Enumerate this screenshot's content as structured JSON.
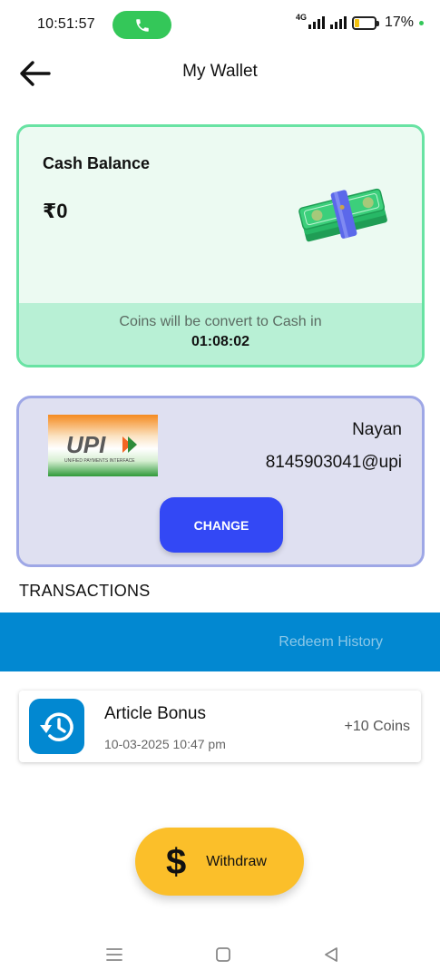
{
  "status_bar": {
    "time": "10:51:57",
    "network": "4G",
    "battery_percent": "17%",
    "battery_level": 0.17,
    "colors": {
      "call_pill": "#34c759",
      "battery_fill": "#f4c20d"
    }
  },
  "header": {
    "title": "My Wallet",
    "back_icon": "arrow-left-icon"
  },
  "cash_card": {
    "title": "Cash Balance",
    "amount": "₹0",
    "convert_text": "Coins will be convert to Cash in",
    "timer": "01:08:02",
    "illustration": "money-stack-icon",
    "colors": {
      "border": "#68e3a3",
      "background": "#ecfaf2",
      "band": "#b8f0d5"
    }
  },
  "upi_card": {
    "logo_text": "UPI",
    "logo_subtext": "UNIFIED PAYMENTS INTERFACE",
    "name": "Nayan",
    "upi_id": "8145903041@upi",
    "change_label": "CHANGE",
    "colors": {
      "border": "#9ea7e6",
      "background": "#dfe0f1",
      "button": "#3348f5"
    }
  },
  "transactions": {
    "heading": "TRANSACTIONS",
    "tabs": [
      {
        "label": "Redeem History",
        "active": false
      }
    ],
    "items": [
      {
        "title": "Article Bonus",
        "date": "10-03-2025 10:47 pm",
        "amount": "+10 Coins",
        "icon": "history-icon"
      }
    ],
    "colors": {
      "tab_bar": "#0288d1"
    }
  },
  "withdraw": {
    "label": "Withdraw",
    "icon_glyph": "$",
    "icon": "dollar-icon",
    "color": "#fbbf2a"
  },
  "nav_bar": {
    "items": [
      "menu-icon",
      "home-square-icon",
      "back-triangle-icon"
    ]
  }
}
